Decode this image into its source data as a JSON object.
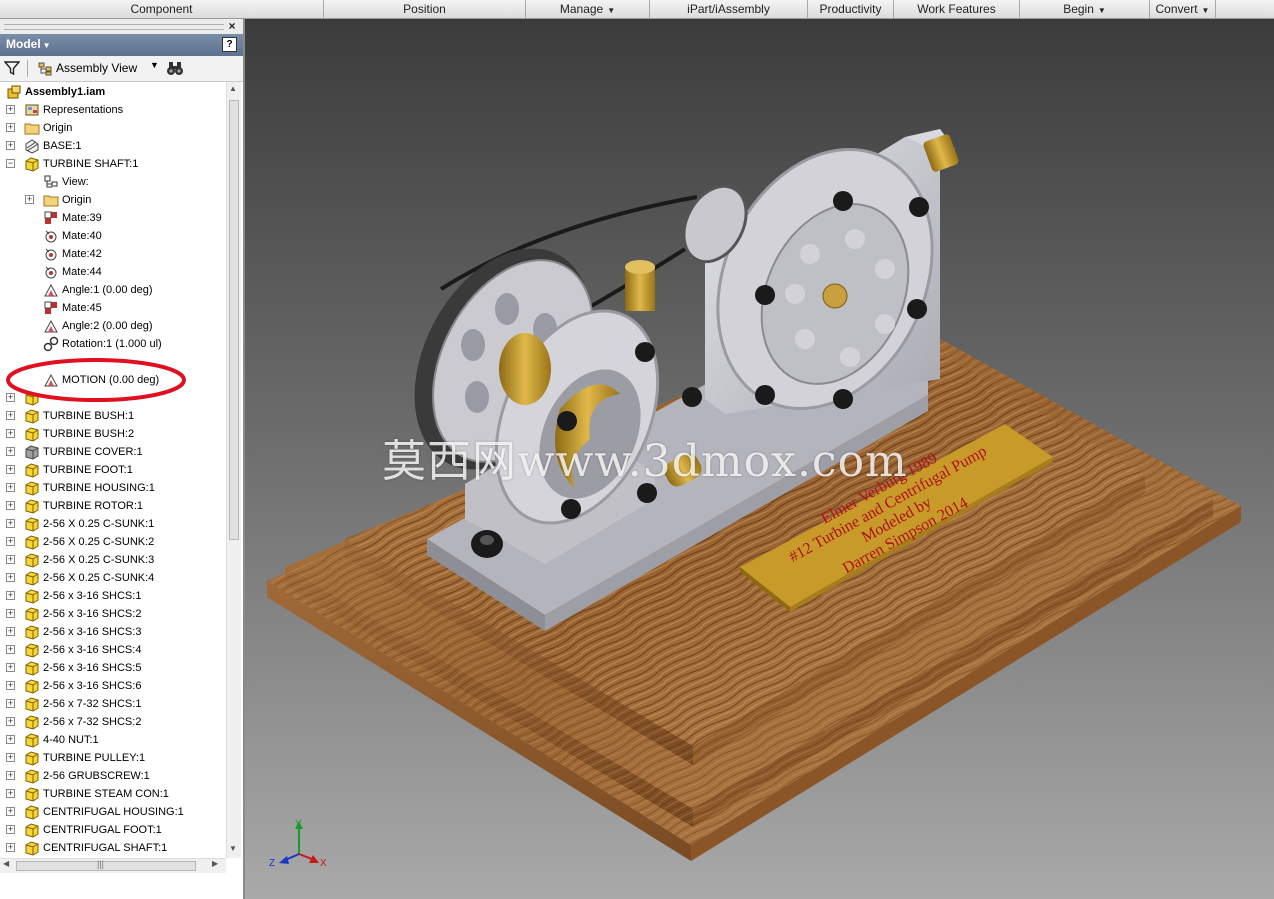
{
  "ribbon": {
    "tabs": [
      {
        "label": "Component",
        "dropdown": false
      },
      {
        "label": "Position",
        "dropdown": false
      },
      {
        "label": "Manage",
        "dropdown": true
      },
      {
        "label": "iPart/iAssembly",
        "dropdown": false
      },
      {
        "label": "Productivity",
        "dropdown": false
      },
      {
        "label": "Work Features",
        "dropdown": false
      },
      {
        "label": "Begin",
        "dropdown": true
      },
      {
        "label": "Convert",
        "dropdown": true
      }
    ]
  },
  "panel": {
    "close_glyph": "×",
    "title": "Model",
    "help_glyph": "?",
    "view_label": "Assembly View",
    "icons": {
      "filter": "filter-icon",
      "find": "binoculars-icon",
      "assembly_view": "hierarchy-icon"
    }
  },
  "tree": [
    {
      "label": "Assembly1.iam",
      "icon": "assembly",
      "level": 0,
      "expander": "",
      "bold": true
    },
    {
      "label": "Representations",
      "icon": "representations",
      "level": 1,
      "expander": "+"
    },
    {
      "label": "Origin",
      "icon": "folder",
      "level": 1,
      "expander": "+"
    },
    {
      "label": "BASE:1",
      "icon": "grounded-part",
      "level": 1,
      "expander": "+"
    },
    {
      "label": "TURBINE SHAFT:1",
      "icon": "part",
      "level": 1,
      "expander": "-"
    },
    {
      "label": "View:",
      "icon": "view",
      "level": 2,
      "expander": ""
    },
    {
      "label": "Origin",
      "icon": "folder",
      "level": 2,
      "expander": "+"
    },
    {
      "label": "Mate:39",
      "icon": "mate",
      "level": 2,
      "expander": ""
    },
    {
      "label": "Mate:40",
      "icon": "insert",
      "level": 2,
      "expander": ""
    },
    {
      "label": "Mate:42",
      "icon": "insert",
      "level": 2,
      "expander": ""
    },
    {
      "label": "Mate:44",
      "icon": "insert",
      "level": 2,
      "expander": ""
    },
    {
      "label": "Angle:1 (0.00 deg)",
      "icon": "angle",
      "level": 2,
      "expander": ""
    },
    {
      "label": "Mate:45",
      "icon": "mate",
      "level": 2,
      "expander": ""
    },
    {
      "label": "Angle:2 (0.00 deg)",
      "icon": "angle",
      "level": 2,
      "expander": ""
    },
    {
      "label": "Rotation:1 (1.000 ul)",
      "icon": "rotation",
      "level": 2,
      "expander": ""
    },
    {
      "label": "",
      "icon": "none",
      "level": 2,
      "expander": ""
    },
    {
      "label": "MOTION (0.00 deg)",
      "icon": "angle",
      "level": 2,
      "expander": ""
    },
    {
      "label": "",
      "icon": "part",
      "level": 1,
      "expander": "+"
    },
    {
      "label": "TURBINE BUSH:1",
      "icon": "part",
      "level": 1,
      "expander": "+"
    },
    {
      "label": "TURBINE BUSH:2",
      "icon": "part",
      "level": 1,
      "expander": "+"
    },
    {
      "label": "TURBINE COVER:1",
      "icon": "part-gray",
      "level": 1,
      "expander": "+"
    },
    {
      "label": "TURBINE FOOT:1",
      "icon": "part",
      "level": 1,
      "expander": "+"
    },
    {
      "label": "TURBINE HOUSING:1",
      "icon": "part",
      "level": 1,
      "expander": "+"
    },
    {
      "label": "TURBINE ROTOR:1",
      "icon": "part",
      "level": 1,
      "expander": "+"
    },
    {
      "label": "2-56 X 0.25 C-SUNK:1",
      "icon": "part",
      "level": 1,
      "expander": "+"
    },
    {
      "label": "2-56 X 0.25 C-SUNK:2",
      "icon": "part",
      "level": 1,
      "expander": "+"
    },
    {
      "label": "2-56 X 0.25 C-SUNK:3",
      "icon": "part",
      "level": 1,
      "expander": "+"
    },
    {
      "label": "2-56 X 0.25 C-SUNK:4",
      "icon": "part",
      "level": 1,
      "expander": "+"
    },
    {
      "label": "2-56 x 3-16 SHCS:1",
      "icon": "part",
      "level": 1,
      "expander": "+"
    },
    {
      "label": "2-56 x 3-16 SHCS:2",
      "icon": "part",
      "level": 1,
      "expander": "+"
    },
    {
      "label": "2-56 x 3-16 SHCS:3",
      "icon": "part",
      "level": 1,
      "expander": "+"
    },
    {
      "label": "2-56 x 3-16 SHCS:4",
      "icon": "part",
      "level": 1,
      "expander": "+"
    },
    {
      "label": "2-56 x 3-16 SHCS:5",
      "icon": "part",
      "level": 1,
      "expander": "+"
    },
    {
      "label": "2-56 x 3-16 SHCS:6",
      "icon": "part",
      "level": 1,
      "expander": "+"
    },
    {
      "label": "2-56 x 7-32 SHCS:1",
      "icon": "part",
      "level": 1,
      "expander": "+"
    },
    {
      "label": "2-56 x 7-32 SHCS:2",
      "icon": "part",
      "level": 1,
      "expander": "+"
    },
    {
      "label": "4-40 NUT:1",
      "icon": "part",
      "level": 1,
      "expander": "+"
    },
    {
      "label": "TURBINE PULLEY:1",
      "icon": "part",
      "level": 1,
      "expander": "+"
    },
    {
      "label": "2-56 GRUBSCREW:1",
      "icon": "part",
      "level": 1,
      "expander": "+"
    },
    {
      "label": "TURBINE STEAM CON:1",
      "icon": "part",
      "level": 1,
      "expander": "+"
    },
    {
      "label": "CENTRIFUGAL HOUSING:1",
      "icon": "part",
      "level": 1,
      "expander": "+"
    },
    {
      "label": "CENTRIFUGAL FOOT:1",
      "icon": "part",
      "level": 1,
      "expander": "+"
    },
    {
      "label": "CENTRIFUGAL SHAFT:1",
      "icon": "part",
      "level": 1,
      "expander": "+"
    }
  ],
  "scroll": {
    "h_grip": "|||",
    "arrow_up": "▲",
    "arrow_down": "▼",
    "arrow_left": "◀",
    "arrow_right": "▶"
  },
  "viewport": {
    "plaque_lines": [
      "Elmer Verburg 1989",
      "#12 Turbine and Centrifugal Pump",
      "Modeled by",
      "Darren Simpson 2014"
    ],
    "watermark": "莫西网www.3dmox.com",
    "axis": {
      "x": "X",
      "y": "Y",
      "z": "Z"
    },
    "colors": {
      "wood": "#9c6a3c",
      "metal": "#c6c6cc",
      "brass": "#c79a2a",
      "highlight": "#e01020",
      "panel_header": "#6b7f9c"
    }
  }
}
